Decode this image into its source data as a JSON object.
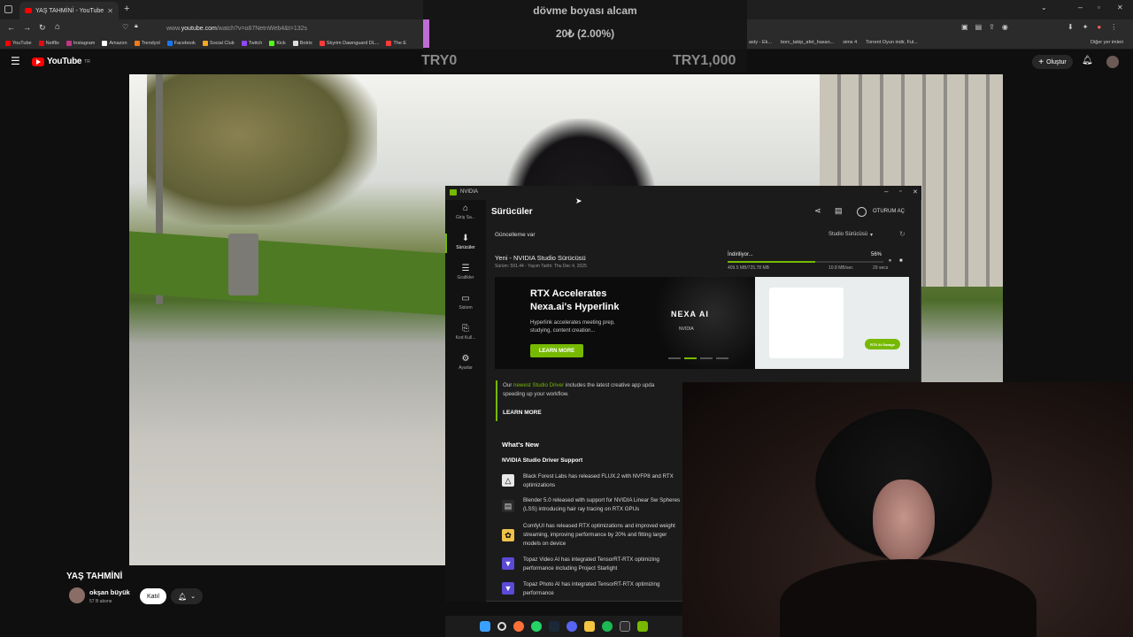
{
  "browser": {
    "tab_title": "YAŞ TAHMİNİ - YouTube",
    "url_prefix": "www.",
    "url_host": "youtube.com",
    "url_path": "/watch?v=o87NetnWeb4&t=132s",
    "bookmarks": [
      {
        "label": "YouTube",
        "color": "#ff0000"
      },
      {
        "label": "Netflix",
        "color": "#e50914"
      },
      {
        "label": "Instagram",
        "color": "#c13584"
      },
      {
        "label": "Amazon",
        "color": "#ffffff"
      },
      {
        "label": "Trendyol",
        "color": "#f27a1a"
      },
      {
        "label": "Facebook",
        "color": "#1877f2"
      },
      {
        "label": "Social Club",
        "color": "#f5a623"
      },
      {
        "label": "Twitch",
        "color": "#9146ff"
      },
      {
        "label": "Kick",
        "color": "#53fc18"
      },
      {
        "label": "Botrix",
        "color": "#dddddd"
      },
      {
        "label": "Skyrim Dawnguard DL...",
        "color": "#ff3b3b"
      },
      {
        "label": "The E",
        "color": "#ff3b3b"
      }
    ],
    "bookmarks_right": [
      {
        "label": "asty - Ek..."
      },
      {
        "label": "borc_takip_afet_hasan..."
      },
      {
        "label": "sims 4"
      },
      {
        "label": "Torrent Oyun indir, Ful..."
      }
    ],
    "other_bookmarks": "Diğer yer imleri"
  },
  "donation": {
    "title": "dövme boyası alcam",
    "progress_text": "20₺ (2.00%)",
    "progress": 0.02,
    "min": "TRY0",
    "max": "TRY1,000"
  },
  "youtube": {
    "logo": "YouTube",
    "country": "TR",
    "create_label": "Oluştur",
    "video_title": "YAŞ TAHMİNİ",
    "channel_name": "okşan büyük",
    "subscribers": "57 B abone",
    "join_label": "Katıl"
  },
  "nvidia": {
    "window_title": "NVIDIA",
    "nav": [
      {
        "label": "Giriş Sa...",
        "icon": "home-icon",
        "glyph": "⌂"
      },
      {
        "label": "Sürücüler",
        "icon": "driver-icon",
        "glyph": "⬇"
      },
      {
        "label": "Grafikler",
        "icon": "sliders-icon",
        "glyph": "☰"
      },
      {
        "label": "Sistem",
        "icon": "monitor-icon",
        "glyph": "▭"
      },
      {
        "label": "Kod Kull...",
        "icon": "redeem-icon",
        "glyph": "⎘"
      },
      {
        "label": "Ayarlar",
        "icon": "gear-icon",
        "glyph": "⚙"
      }
    ],
    "page_title": "Sürücüler",
    "login": "OTURUM AÇ",
    "update_available": "Güncelleme var",
    "driver_type": "Studio Sürücüsü",
    "new_driver": "Yeni - NVIDIA Studio Sürücüsü",
    "driver_meta": "Sürüm: 591.44 - Yayım Tarihi: Thu Dec 4, 2025",
    "download_status": "İndiriliyor...",
    "download_percent": "56%",
    "download_progress": 0.56,
    "download_size": "409.5 MB/725.78 MB",
    "download_speed": "10.8 MB/sec",
    "time_left": "29 secs",
    "banner_title": "RTX Accelerates Nexa.ai's Hyperlink",
    "banner_desc": "Hyperlink accelerates meeting prep, studying, content creation...",
    "banner_btn": "LEARN MORE",
    "banner_logo": "NEXA AI",
    "banner_logo_sub": "NVIDIA",
    "banner_screen_btn": "RTX AI Garage",
    "info_pre": "Our ",
    "info_link": "newest Studio Driver",
    "info_post": " includes the latest creative app upda",
    "info_line2": "speeding up your workflow.",
    "learn_more": "LEARN MORE",
    "whats_new": "What's New",
    "support_title": "NVIDIA Studio Driver Support",
    "items": [
      {
        "icon": "flux-icon",
        "glyph": "△",
        "text": "Black Forest Labs has released FLUX.2 with NVFP8 and RTX optimizations"
      },
      {
        "icon": "document-icon",
        "glyph": "▤",
        "text": "Blender 5.0 released with support for NVIDIA Linear Sw Spheres (LSS) introducing hair ray tracing on RTX GPUs"
      },
      {
        "icon": "comfyui-icon",
        "glyph": "✿",
        "text": "ComfyUI has released RTX optimizations and improved weight streaming, improving performance by 20% and fitting larger models on device"
      },
      {
        "icon": "topaz-video-icon",
        "glyph": "▼",
        "text": "Topaz Video AI has integrated TensorRT-RTX optimizing performance including Project Starlight"
      },
      {
        "icon": "topaz-photo-icon",
        "glyph": "▼",
        "text": "Topaz Photo AI has integrated TensorRT-RTX optimizing performance"
      }
    ]
  },
  "colors": {
    "nvidia_green": "#76b900",
    "youtube_red": "#ff0000",
    "donation_purple": "#c06cd6"
  }
}
